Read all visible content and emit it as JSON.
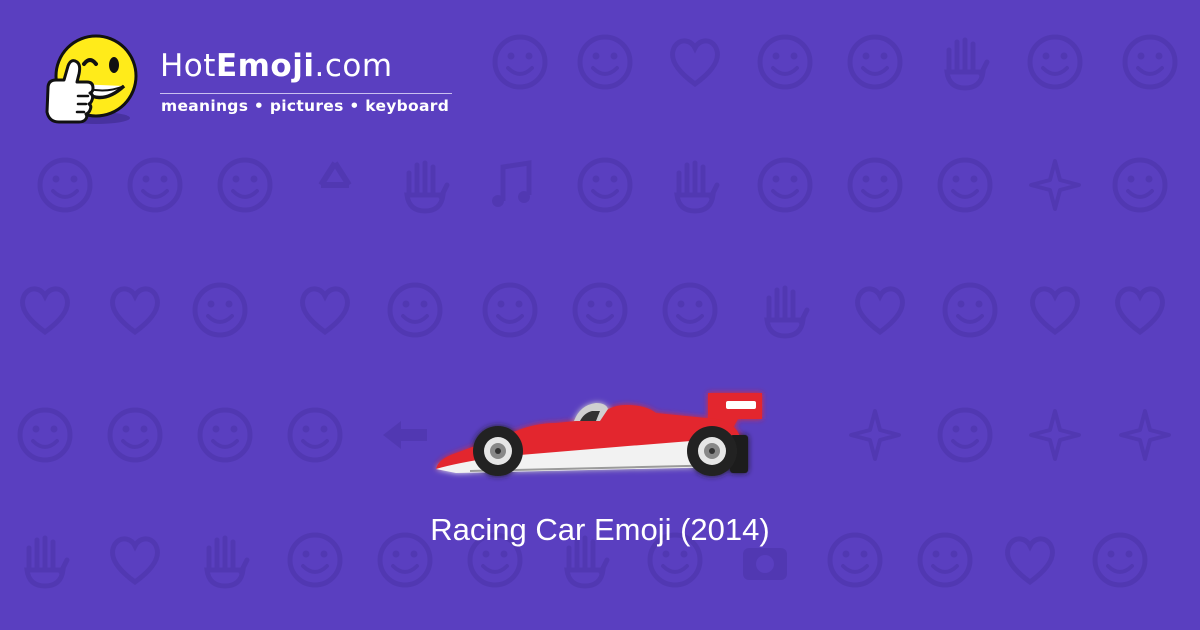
{
  "brand": {
    "name_part1": "Hot",
    "name_part2": "Emoji",
    "name_part3": ".com",
    "tagline": "meanings • pictures • keyboard",
    "logo_icon": "thumbs-up-winking-face-icon"
  },
  "emoji": {
    "icon": "racing-car-icon",
    "caption": "Racing Car Emoji (2014)"
  },
  "colors": {
    "background": "#5a3fc0",
    "pattern": "#4a33a6",
    "text": "#ffffff",
    "car_red": "#e3262d",
    "logo_yellow": "#ffeb1a"
  },
  "background_pattern": {
    "icons": [
      "smile-icon",
      "kiss-icon",
      "hearts-icon",
      "smile-icon",
      "weary-icon",
      "ok-hand-icon",
      "neutral-icon",
      "eyes-icon",
      "smirk-icon",
      "relieved-icon",
      "grimace-icon",
      "recycle-icon",
      "raised-hands-icon",
      "music-notes-icon",
      "see-no-evil-icon",
      "victory-hand-icon",
      "sleeping-icon",
      "frown-icon",
      "grin-icon",
      "sparkles-icon",
      "grin-icon",
      "striped-heart-icon",
      "broken-heart-icon",
      "confused-icon",
      "striped-heart-icon",
      "tongue-wink-icon",
      "frown-icon",
      "yum-icon",
      "neutral-icon",
      "raised-hand-icon",
      "heart-arrow-icon",
      "anguished-icon",
      "hearts-icon",
      "heart-icon",
      "see-no-evil-icon",
      "scream-icon",
      "smiling-devil-icon",
      "angry-icon",
      "arrow-left-icon",
      "fire-icon",
      "tongue-squint-icon",
      "rose-icon",
      "sun-icon",
      "flexed-biceps-icon",
      "striped-heart-icon",
      "check-mark-icon",
      "squint-laugh-icon",
      "moon-face-icon",
      "cat-face-icon",
      "wave-hand-icon",
      "grimace-icon",
      "camera-icon",
      "frown-icon",
      "laugh-icon",
      "striped-heart-icon",
      "grin-icon",
      "beating-heart-icon",
      "kiss-icon"
    ]
  }
}
